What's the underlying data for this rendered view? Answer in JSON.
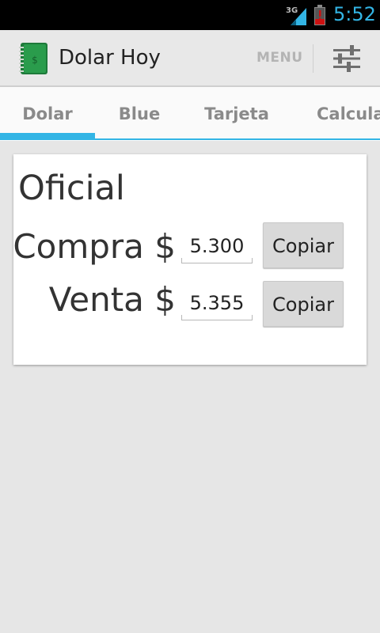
{
  "status_bar": {
    "network": "3G",
    "time": "5:52",
    "colors": {
      "accent": "#33b5e5",
      "battery_warning": "#cc1111"
    }
  },
  "action_bar": {
    "app_icon": "green-notebook-icon",
    "title": "Dolar Hoy",
    "menu_label": "MENU",
    "settings_icon": "sliders-icon"
  },
  "tabs": [
    {
      "label": "Dolar",
      "selected": true
    },
    {
      "label": "Blue",
      "selected": false
    },
    {
      "label": "Tarjeta",
      "selected": false
    },
    {
      "label": "Calcular",
      "selected": false
    }
  ],
  "card": {
    "title": "Oficial",
    "rows": [
      {
        "label": "Compra $",
        "value": "5.300",
        "button": "Copiar"
      },
      {
        "label": "Venta $",
        "value": "5.355",
        "button": "Copiar"
      }
    ]
  }
}
